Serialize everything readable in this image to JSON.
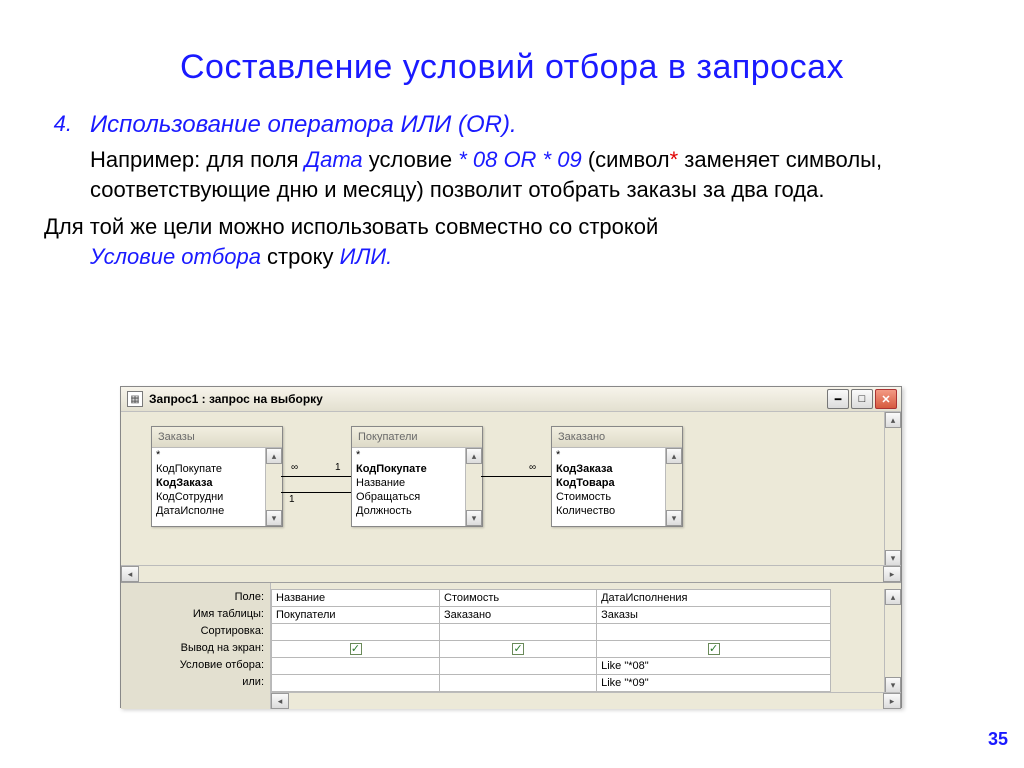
{
  "slide": {
    "title": "Составление условий отбора в запросах",
    "list_number": "4.",
    "list_text": "Использование оператора ИЛИ (OR).",
    "p1_lead": "Например:",
    "p1_a": " для поля ",
    "p1_field": "Дата",
    "p1_b": " условие ",
    "p1_cond": "* 08 OR * 09",
    "p1_c": " (символ",
    "p1_star": "*",
    "p1_d": " заменяет символы, соответствующие дню и месяцу) позволит отобрать заказы за два года.",
    "p2_a": "Для той же цели можно использовать совместно со строкой",
    "p2_crit": "Условие отбора",
    "p2_b": " строку ",
    "p2_or": "ИЛИ.",
    "page_number": "35"
  },
  "window": {
    "title": "Запрос1 : запрос на выборку",
    "tables": {
      "t1_name": "Заказы",
      "t1_fields": [
        "*",
        "КодПокупате",
        "КодЗаказа",
        "КодСотрудни",
        "ДатаИсполне"
      ],
      "t2_name": "Покупатели",
      "t2_fields": [
        "*",
        "КодПокупате",
        "Название",
        "Обращаться",
        "Должность"
      ],
      "t3_name": "Заказано",
      "t3_fields": [
        "*",
        "КодЗаказа",
        "КодТовара",
        "Стоимость",
        "Количество"
      ]
    },
    "rel": {
      "inf": "∞",
      "one": "1"
    },
    "row_labels": {
      "field": "Поле:",
      "table": "Имя таблицы:",
      "sort": "Сортировка:",
      "show": "Вывод на экран:",
      "criteria": "Условие отбора:",
      "or": "или:"
    },
    "grid": {
      "c1_field": "Название",
      "c1_table": "Покупатели",
      "c2_field": "Стоимость",
      "c2_table": "Заказано",
      "c3_field": "ДатаИсполнения",
      "c3_table": "Заказы",
      "c3_criteria": "Like \"*08\"",
      "c3_or": "Like \"*09\""
    },
    "check": "✓"
  }
}
